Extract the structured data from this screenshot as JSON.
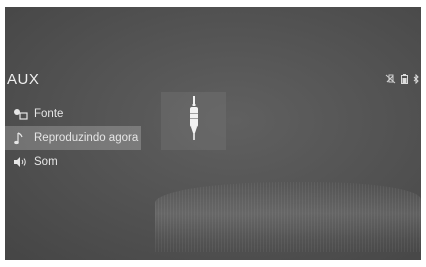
{
  "header": {
    "source_title": "AUX"
  },
  "status_icons": [
    {
      "icon": "phone-no-signal-icon"
    },
    {
      "icon": "phone-battery-icon"
    },
    {
      "icon": "bluetooth-icon"
    }
  ],
  "menu": {
    "items": [
      {
        "label": "Fonte",
        "icon": "source-icon",
        "active": false
      },
      {
        "label": "Reproduzindo agora",
        "icon": "music-note-icon",
        "active": true
      },
      {
        "label": "Som",
        "icon": "speaker-icon",
        "active": false
      }
    ]
  },
  "now_playing": {
    "art_icon": "aux-plug-icon"
  },
  "colors": {
    "background": "#545454",
    "text": "#e6e6e6",
    "active_highlight": "#8a8a8a"
  }
}
